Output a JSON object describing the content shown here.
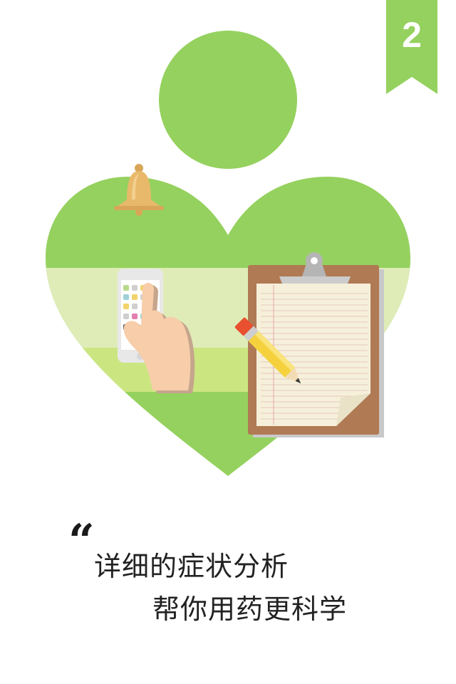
{
  "badge": {
    "number": "2",
    "color": "#95d15e"
  },
  "caption": {
    "quote_mark": "“",
    "line1": "详细的症状分析",
    "line2": "帮你用药更科学"
  },
  "colors": {
    "heart": "#95d15e",
    "band_light": "#dfecb8",
    "band_mid": "#cbe681",
    "clipboard": "#b07a54",
    "pencil": "#f5d23d",
    "bell": "#e8b96a",
    "hand": "#f7cdaa"
  },
  "icons": [
    "bookmark-badge-icon",
    "head-circle-icon",
    "heart-shape-icon",
    "bell-icon",
    "phone-icon",
    "hand-icon",
    "clipboard-icon",
    "pencil-icon"
  ]
}
